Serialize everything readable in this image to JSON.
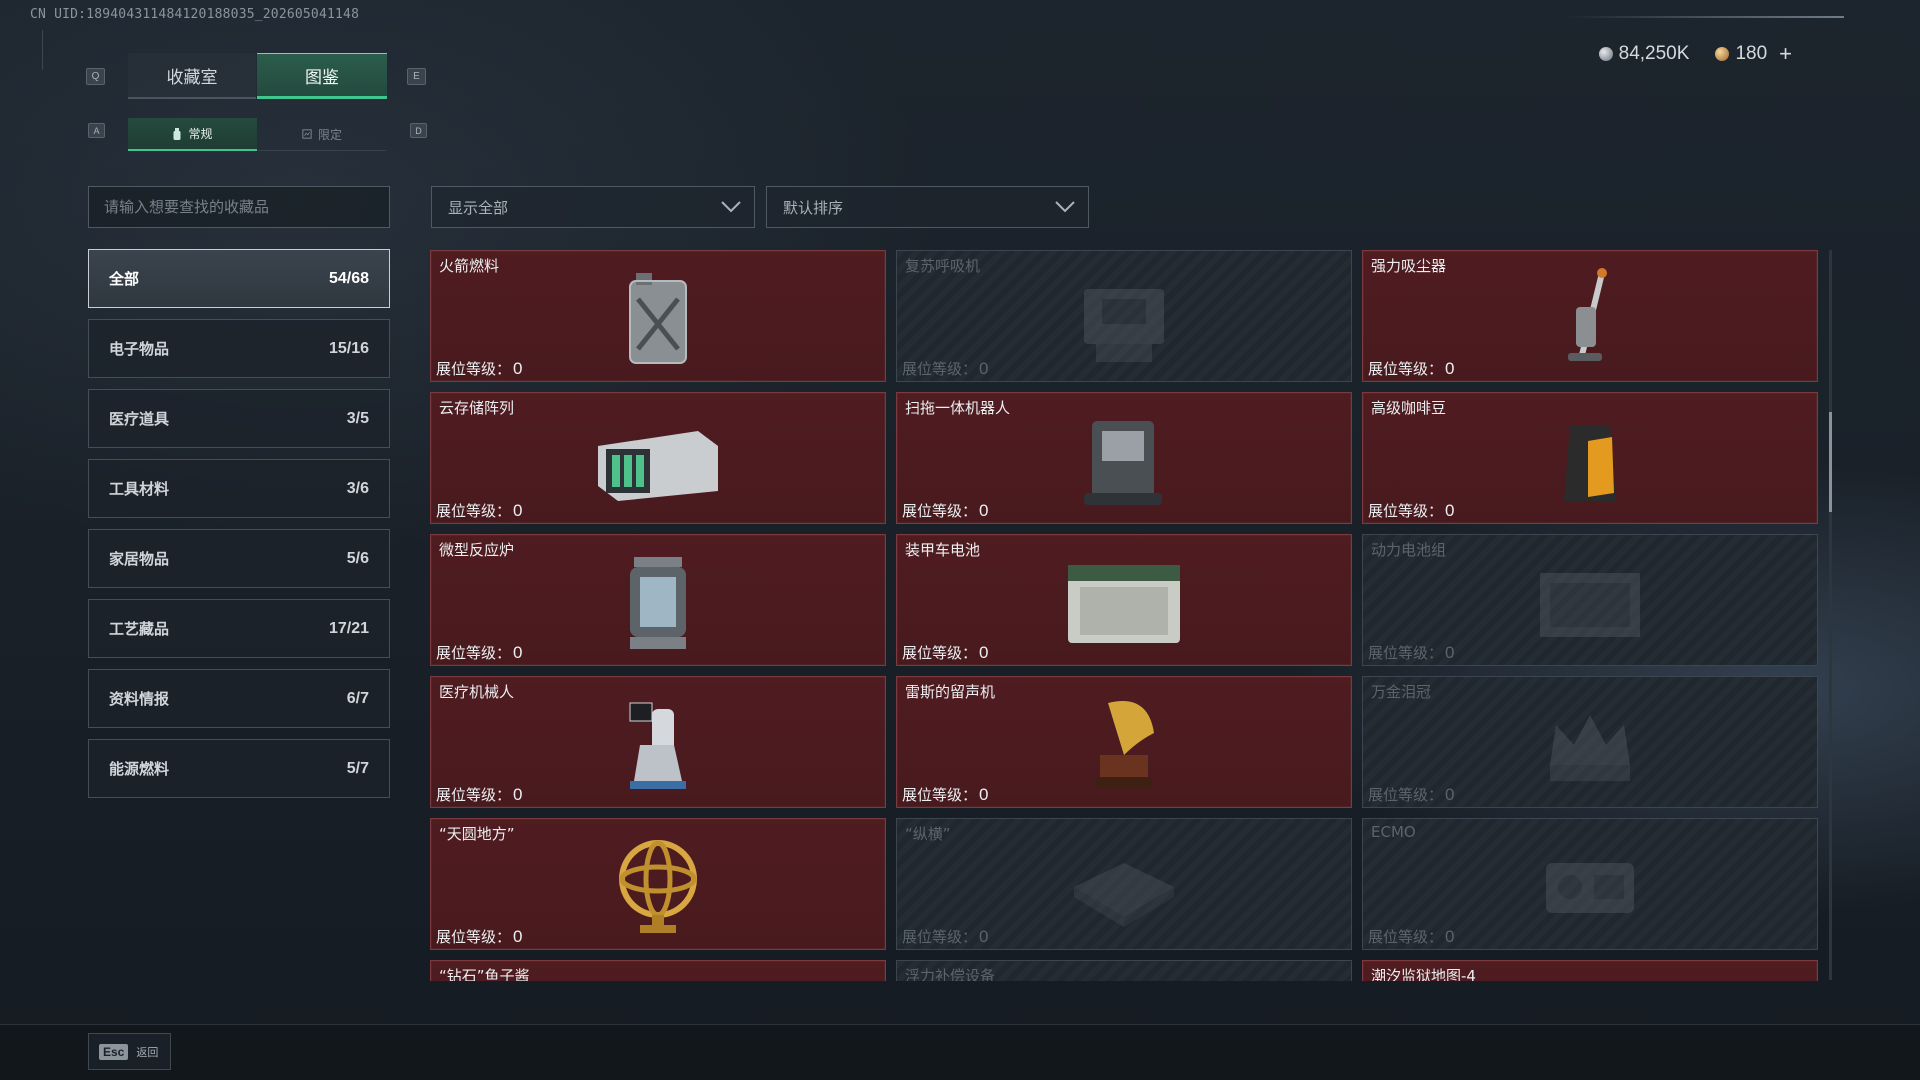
{
  "uid": "CN UID:1894043114841201880​35_202605041148",
  "currency": [
    {
      "icon": "silver-coin-icon",
      "value": "84,250K"
    },
    {
      "icon": "gold-coin-icon",
      "value": "180"
    }
  ],
  "currency_plus": "+",
  "keys": {
    "q": "Q",
    "e": "E",
    "a": "A",
    "d": "D"
  },
  "tabs": [
    {
      "label": "收藏室",
      "active": false
    },
    {
      "label": "图鉴",
      "active": true
    }
  ],
  "subtabs": [
    {
      "label": "常规",
      "active": true
    },
    {
      "label": "限定",
      "active": false
    }
  ],
  "search": {
    "placeholder": "请输入想要查找的收藏品",
    "value": ""
  },
  "filters": {
    "show": "显示全部",
    "sort": "默认排序"
  },
  "categories": [
    {
      "label": "全部",
      "count": "54/68",
      "active": true
    },
    {
      "label": "电子物品",
      "count": "15/16",
      "active": false
    },
    {
      "label": "医疗道具",
      "count": "3/5",
      "active": false
    },
    {
      "label": "工具材料",
      "count": "3/6",
      "active": false
    },
    {
      "label": "家居物品",
      "count": "5/6",
      "active": false
    },
    {
      "label": "工艺藏品",
      "count": "17/21",
      "active": false
    },
    {
      "label": "资料情报",
      "count": "6/7",
      "active": false
    },
    {
      "label": "能源燃料",
      "count": "5/7",
      "active": false
    }
  ],
  "level_label": "展位等级：",
  "items": [
    {
      "name": "火箭燃料",
      "level": "0",
      "owned": true,
      "icon": "fuel-canister-icon"
    },
    {
      "name": "复苏呼吸机",
      "level": "0",
      "owned": false,
      "icon": "ventilator-icon"
    },
    {
      "name": "强力吸尘器",
      "level": "0",
      "owned": true,
      "icon": "vacuum-cleaner-icon"
    },
    {
      "name": "云存储阵列",
      "level": "0",
      "owned": true,
      "icon": "storage-array-icon"
    },
    {
      "name": "扫拖一体机器人",
      "level": "0",
      "owned": true,
      "icon": "mop-robot-icon"
    },
    {
      "name": "高级咖啡豆",
      "level": "0",
      "owned": true,
      "icon": "coffee-bag-icon"
    },
    {
      "name": "微型反应炉",
      "level": "0",
      "owned": true,
      "icon": "reactor-icon"
    },
    {
      "name": "装甲车电池",
      "level": "0",
      "owned": true,
      "icon": "car-battery-icon"
    },
    {
      "name": "动力电池组",
      "level": "0",
      "owned": false,
      "icon": "battery-pack-icon"
    },
    {
      "name": "医疗机械人",
      "level": "0",
      "owned": true,
      "icon": "medical-robot-icon"
    },
    {
      "name": "雷斯的留声机",
      "level": "0",
      "owned": true,
      "icon": "gramophone-icon"
    },
    {
      "name": "万金泪冠",
      "level": "0",
      "owned": false,
      "icon": "crown-icon"
    },
    {
      "name": "“天圆地方”",
      "level": "0",
      "owned": true,
      "icon": "armillary-sphere-icon"
    },
    {
      "name": "“纵横”",
      "level": "0",
      "owned": false,
      "icon": "chessboard-icon"
    },
    {
      "name": "ECMO",
      "level": "0",
      "owned": false,
      "icon": "ecmo-machine-icon"
    },
    {
      "name": "“钻石”鱼子酱",
      "level": "",
      "owned": true,
      "icon": "caviar-icon"
    },
    {
      "name": "浮力补偿设备",
      "level": "",
      "owned": false,
      "icon": "bcd-icon"
    },
    {
      "name": "潮汐监狱地图-4",
      "level": "",
      "owned": true,
      "icon": "map-icon"
    }
  ],
  "footer": {
    "esc_key": "Esc",
    "back_label": "返回"
  }
}
